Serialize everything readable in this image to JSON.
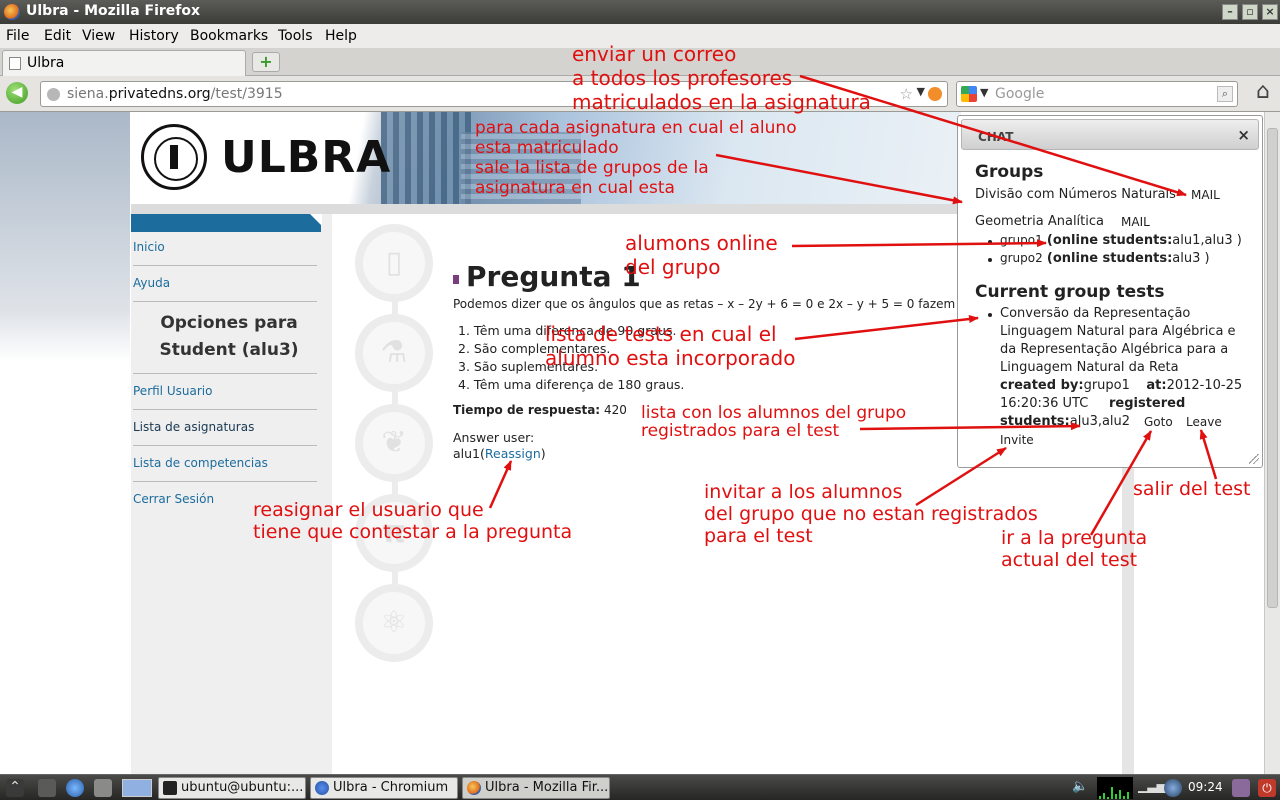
{
  "window": {
    "title": "Ulbra - Mozilla Firefox"
  },
  "menu": [
    "File",
    "Edit",
    "View",
    "History",
    "Bookmarks",
    "Tools",
    "Help"
  ],
  "tab": {
    "label": "Ulbra"
  },
  "address": {
    "url_prefix": "siena.",
    "url_host": "privatedns.org",
    "url_path": "/test/3915"
  },
  "search": {
    "placeholder": "Google"
  },
  "banner": {
    "logo": "ULBRA"
  },
  "sidebar": {
    "items_top": [
      "Inicio",
      "Ayuda"
    ],
    "heading": "Opciones para Student (alu3)",
    "items_bottom": [
      "Perfil Usuario",
      "Lista de asignaturas",
      "Lista de competencias",
      "Cerrar Sesión"
    ]
  },
  "question": {
    "title": "Pregunta 1",
    "text": "Podemos dizer que os ângulos que as retas – x – 2y + 6 = 0 e 2x – y + 5 = 0 fazem com o eixo",
    "options": [
      "1.  Têm uma diferença de 90 graus.",
      "2.  São complementares.",
      "3.  São suplementares.",
      "4.  Têm uma diferença de 180 graus."
    ],
    "time_label": "Tiempo de respuesta:",
    "time_value": "420",
    "answer_label": "Answer user:",
    "answer_user": "alu1",
    "reassign": "Reassign"
  },
  "chat": {
    "title": "CHAT",
    "close": "×",
    "groups_heading": "Groups",
    "group1_name": "Divisão com Números Naturais",
    "group2_name": "Geometria Analítica",
    "mail": "MAIL",
    "subgroups": [
      {
        "name": "grupo1",
        "label": "online students:",
        "students": "alu1,alu3 )"
      },
      {
        "name": "grupo2",
        "label": "online students:",
        "students": "alu3 )"
      }
    ],
    "tests_heading": "Current group tests",
    "test_title_lines": [
      "Conversão da Representação",
      "Linguagem Natural para Algébrica e",
      "da Representação Algébrica para a",
      "Linguagem Natural da Reta"
    ],
    "created_by_label": "created by:",
    "created_by": "grupo1",
    "at_label": "at:",
    "at_date": "2012-10-25",
    "at_time": "16:20:36 UTC",
    "registered_label": "registered",
    "students_label": "students:",
    "students": "alu3,alu2",
    "goto": "Goto",
    "leave": "Leave",
    "invite": "Invite"
  },
  "annotations": {
    "mail_note": [
      "enviar un correo",
      "a todos los profesores",
      "matriculados en la asignatura"
    ],
    "groups_note": [
      "para cada asignatura en cual el aluno",
      "esta matriculado",
      "sale la lista de grupos de la",
      "asignatura en cual esta"
    ],
    "online_note": [
      "alumons online",
      "del grupo"
    ],
    "tests_note": [
      "lista de tests en cual el",
      "alumno esta incorporado"
    ],
    "registered_note": [
      "lista con los alumnos del grupo",
      "registrados para el test"
    ],
    "reassign_note": [
      "reasignar el usuario que",
      "tiene que contestar a la pregunta"
    ],
    "invite_note": [
      "invitar a los alumnos",
      "del grupo que no estan registrados",
      "para el test"
    ],
    "goto_note": [
      "ir a la pregunta",
      "actual del test"
    ],
    "leave_note": [
      "salir del test"
    ]
  },
  "taskbar": {
    "tasks": [
      "ubuntu@ubuntu:...",
      "Ulbra - Chromium",
      "Ulbra - Mozilla Fir..."
    ],
    "clock": "09:24"
  },
  "colors": {
    "annotation": "#e01010",
    "link": "#1c6c9e",
    "sidebar_bar": "#1c6c9e"
  }
}
